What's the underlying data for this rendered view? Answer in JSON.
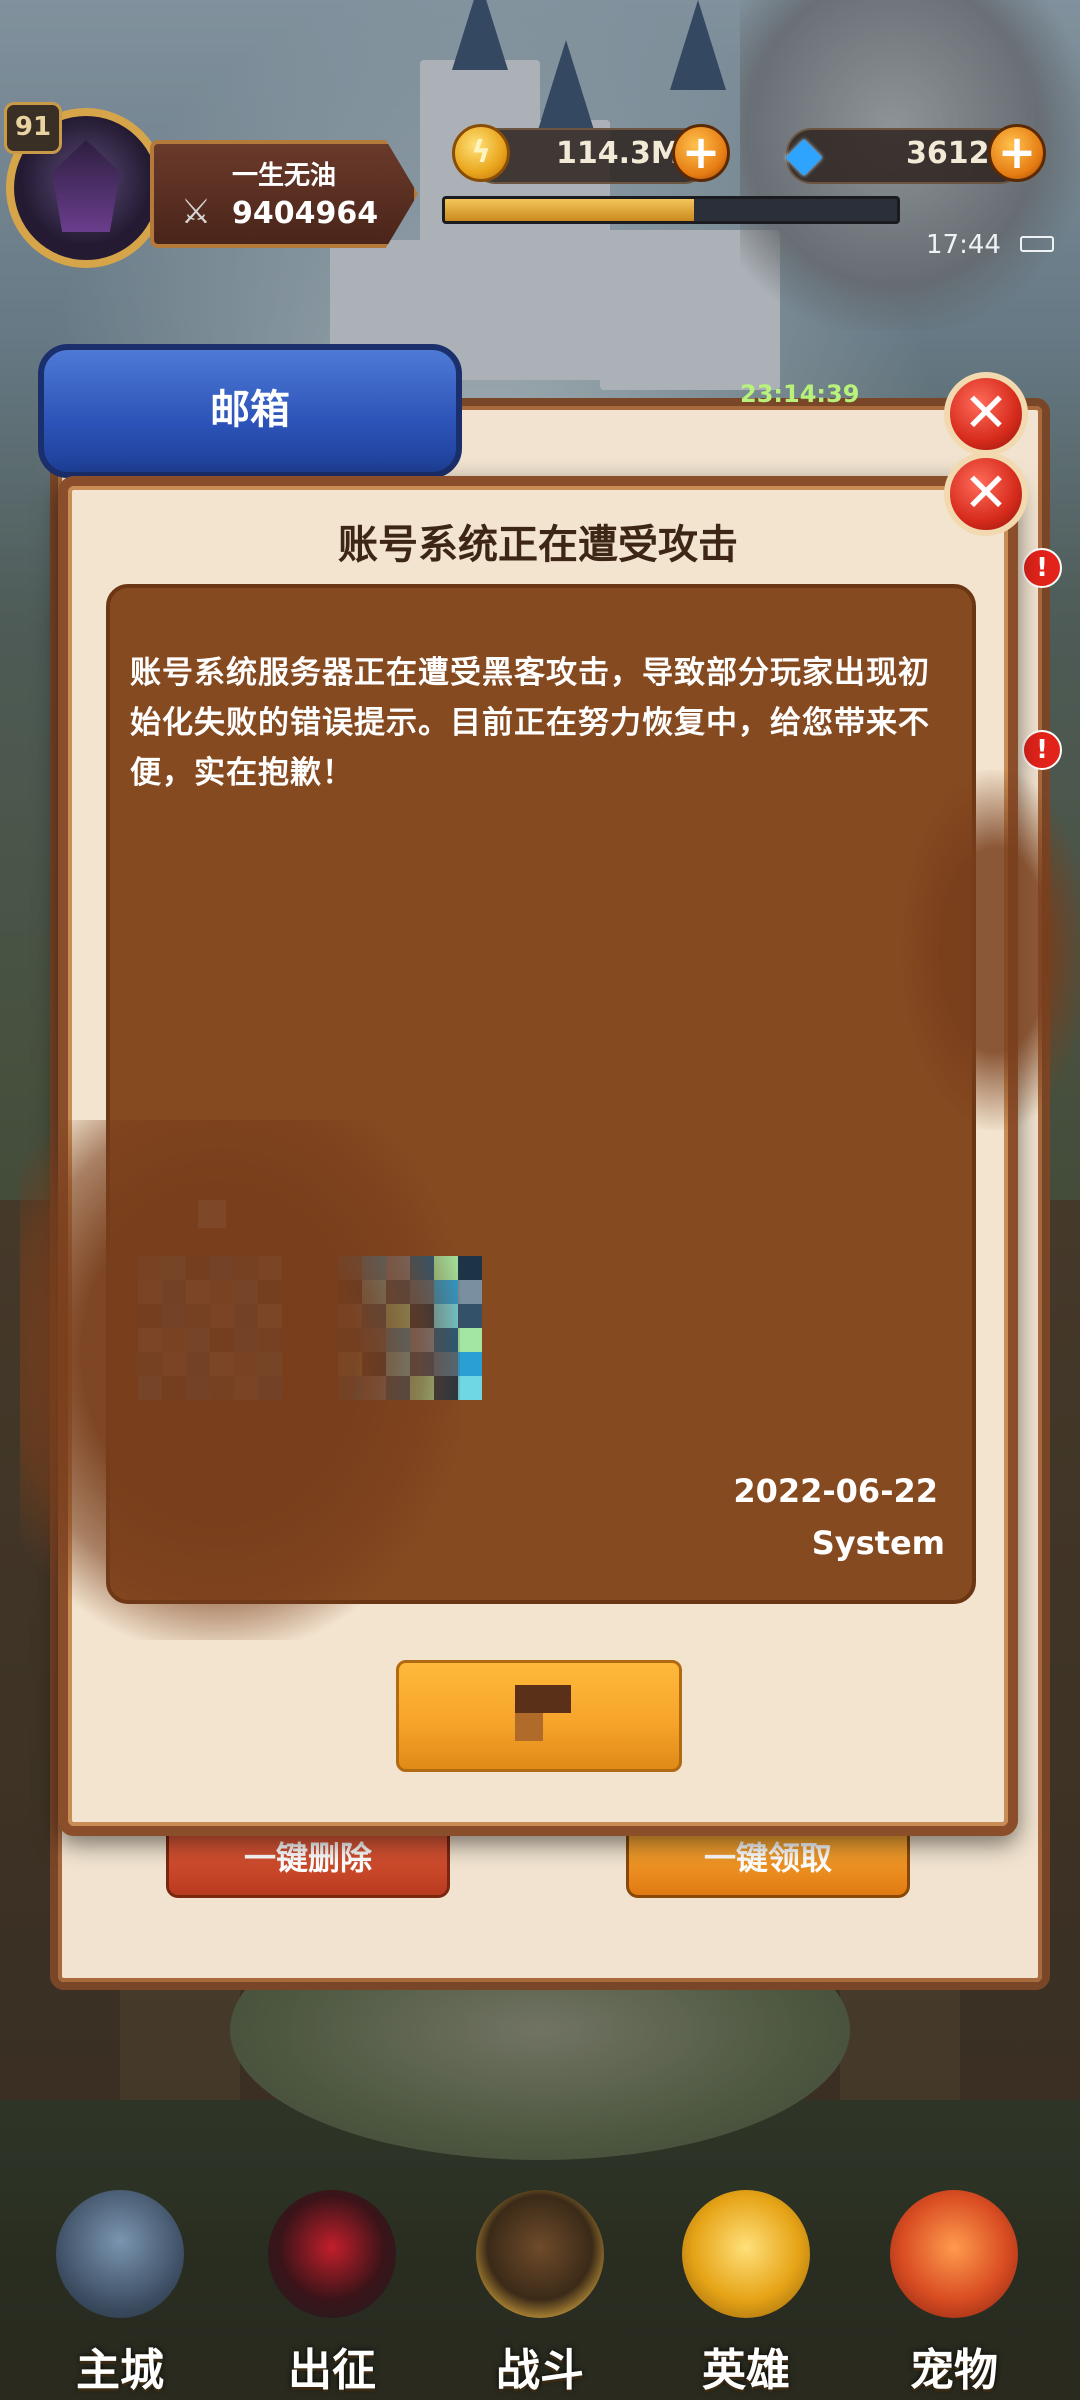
{
  "hud": {
    "level": "91",
    "player_name": "一生无油",
    "power": "9404964",
    "gold": "114.3M",
    "gems": "3612",
    "xp_fraction": 0.55,
    "clock": "17:44",
    "icons": {
      "gold": "coin-icon",
      "gems": "diamond-icon",
      "add": "plus-icon",
      "power": "crossed-swords-icon"
    }
  },
  "mailbox": {
    "tab_label": "邮箱",
    "timer": "23:14:39",
    "delete_all_label": "一键删除",
    "claim_all_label": "一键领取"
  },
  "message": {
    "title": "账号系统正在遭受攻击",
    "body": "账号系统服务器正在遭受黑客攻击，导致部分玩家出现初始化失败的错误提示。目前正在努力恢复中，给您带来不便，实在抱歉！",
    "date": "2022-06-22",
    "sender": "System",
    "confirm_label": ""
  },
  "nav": [
    {
      "label": "主城",
      "icon": "castle-tower-icon"
    },
    {
      "label": "出征",
      "icon": "dark-helmet-icon"
    },
    {
      "label": "战斗",
      "icon": "crossed-swords-shield-icon"
    },
    {
      "label": "英雄",
      "icon": "golden-crown-icon"
    },
    {
      "label": "宠物",
      "icon": "red-dragon-icon"
    }
  ],
  "colors": {
    "panel": "#864a20",
    "frame": "#8b4e2b",
    "parchment": "#f3e4cf",
    "tab_blue": "#2c53b8",
    "button_orange": "#f6a52a",
    "close_red": "#d62b1c"
  }
}
